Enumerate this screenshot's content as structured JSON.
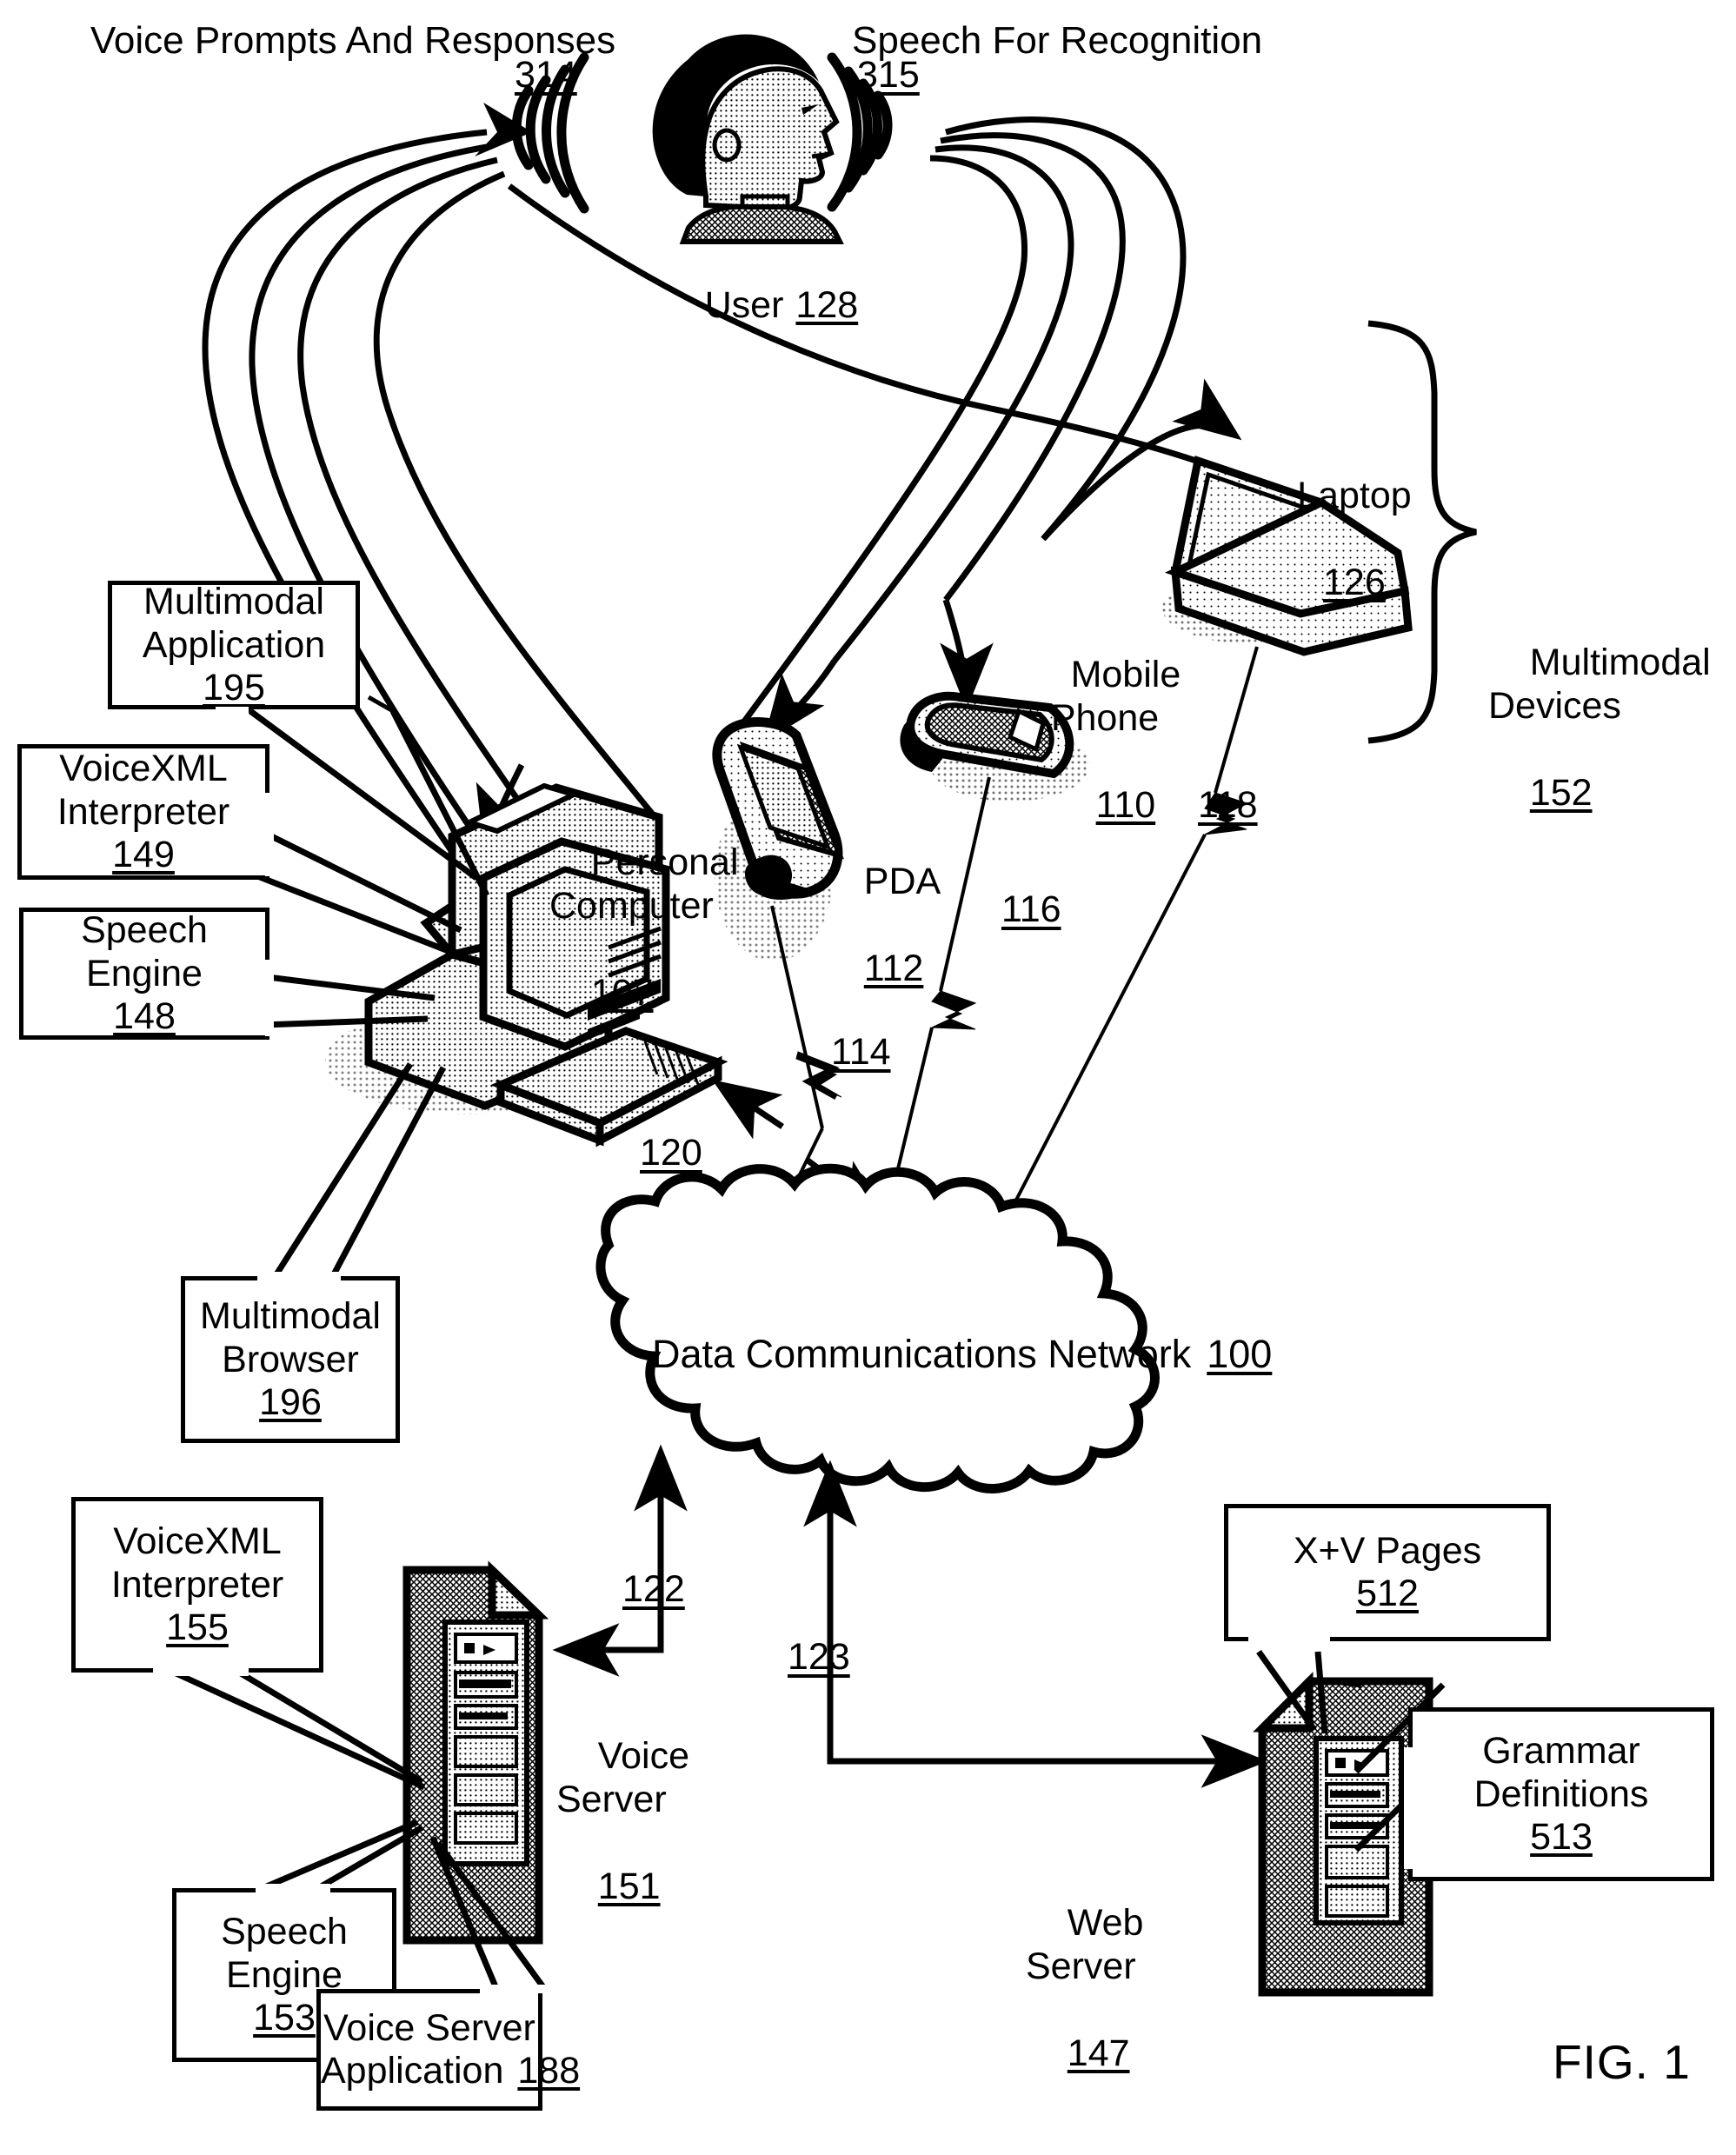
{
  "figure": {
    "caption": "FIG. 1",
    "title_top_left": "Voice Prompts And Responses",
    "title_top_right": "Speech For Recognition"
  },
  "reference_numerals": {
    "voice_prompts": "314",
    "speech_for_recognition": "315",
    "user": "128",
    "laptop": "126",
    "mobile_phone": "110",
    "pda": "112",
    "personal_computer": "107",
    "multimodal_devices": "152",
    "link_pda": "114",
    "link_mobile": "116",
    "link_laptop": "118",
    "link_pc": "120",
    "link_voice_server": "122",
    "link_web_server": "123",
    "network": "100",
    "voice_server": "151",
    "web_server": "147"
  },
  "actors": {
    "user": {
      "label": "User",
      "num": "128"
    }
  },
  "devices": [
    {
      "name": "laptop",
      "label": "Laptop",
      "num": "126"
    },
    {
      "name": "mobile-phone",
      "label": "Mobile\nPhone",
      "num": "110"
    },
    {
      "name": "pda",
      "label": "PDA",
      "num": "112"
    },
    {
      "name": "personal-computer",
      "label": "Personal\nComputer",
      "num": "107"
    }
  ],
  "bracket": {
    "label": "Multimodal\nDevices",
    "num": "152"
  },
  "network": {
    "label": "Data Communications Network",
    "num": "100"
  },
  "servers": [
    {
      "name": "voice-server",
      "label": "Voice\nServer",
      "num": "151"
    },
    {
      "name": "web-server",
      "label": "Web\nServer",
      "num": "147"
    }
  ],
  "callouts": {
    "multimodal_application": {
      "lines": "Multimodal\nApplication",
      "num": "195"
    },
    "voicexml_interpreter_149": {
      "lines": "VoiceXML\nInterpreter",
      "num": "149"
    },
    "speech_engine_148": {
      "lines": "Speech\nEngine",
      "num": "148"
    },
    "multimodal_browser": {
      "lines": "Multimodal\nBrowser",
      "num": "196"
    },
    "voicexml_interpreter_155": {
      "lines": "VoiceXML\nInterpreter",
      "num": "155"
    },
    "speech_engine_153": {
      "lines": "Speech\nEngine",
      "num": "153"
    },
    "voice_server_application": {
      "lines": "Voice Server",
      "tail": "Application",
      "num": "188"
    },
    "xv_pages": {
      "lines": "X+V Pages",
      "num": "512"
    },
    "grammar_definitions": {
      "lines": "Grammar\nDefinitions",
      "num": "513"
    }
  },
  "colors": {
    "ink": "#000000",
    "paper": "#ffffff"
  }
}
